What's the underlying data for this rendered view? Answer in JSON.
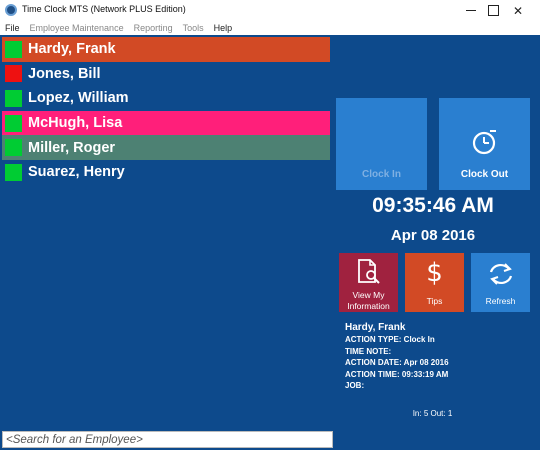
{
  "window": {
    "title": "Time Clock MTS (Network PLUS Edition)"
  },
  "menu": [
    {
      "label": "File",
      "disabled": false
    },
    {
      "label": "Employee Maintenance",
      "disabled": true
    },
    {
      "label": "Reporting",
      "disabled": true
    },
    {
      "label": "Tools",
      "disabled": true
    },
    {
      "label": "Help",
      "disabled": false
    }
  ],
  "employees": [
    {
      "name": "Hardy, Frank",
      "status_color": "#00cc33",
      "row_bg": "#d24a25"
    },
    {
      "name": "Jones, Bill",
      "status_color": "#ee1111",
      "row_bg": ""
    },
    {
      "name": "Lopez, William",
      "status_color": "#00cc33",
      "row_bg": ""
    },
    {
      "name": "McHugh, Lisa",
      "status_color": "#00cc33",
      "row_bg": "#ff1f7a"
    },
    {
      "name": "Miller, Roger",
      "status_color": "#00cc33",
      "row_bg": "#4d8173"
    },
    {
      "name": "Suarez, Henry",
      "status_color": "#00cc33",
      "row_bg": ""
    }
  ],
  "actions": {
    "clock_in": "Clock In",
    "clock_out": "Clock Out",
    "view_info_line1": "View My",
    "view_info_line2": "Information",
    "tips": "Tips",
    "refresh": "Refresh"
  },
  "clock": {
    "time": "09:35:46 AM",
    "date": "Apr 08 2016"
  },
  "details": {
    "name": "Hardy, Frank",
    "action_type": "ACTION TYPE: Clock In",
    "time_note": "TIME NOTE:",
    "action_date": "ACTION DATE: Apr 08 2016",
    "action_time": "ACTION TIME: 09:33:19 AM",
    "job": "JOB:"
  },
  "counts": "In: 5  Out: 1",
  "search": {
    "placeholder": "<Search for an Employee>"
  },
  "colors": {
    "background": "#0d4a8c",
    "tile_blue": "#2a7fd0",
    "tile_red": "#a0223f",
    "tile_orange": "#d24a25"
  }
}
